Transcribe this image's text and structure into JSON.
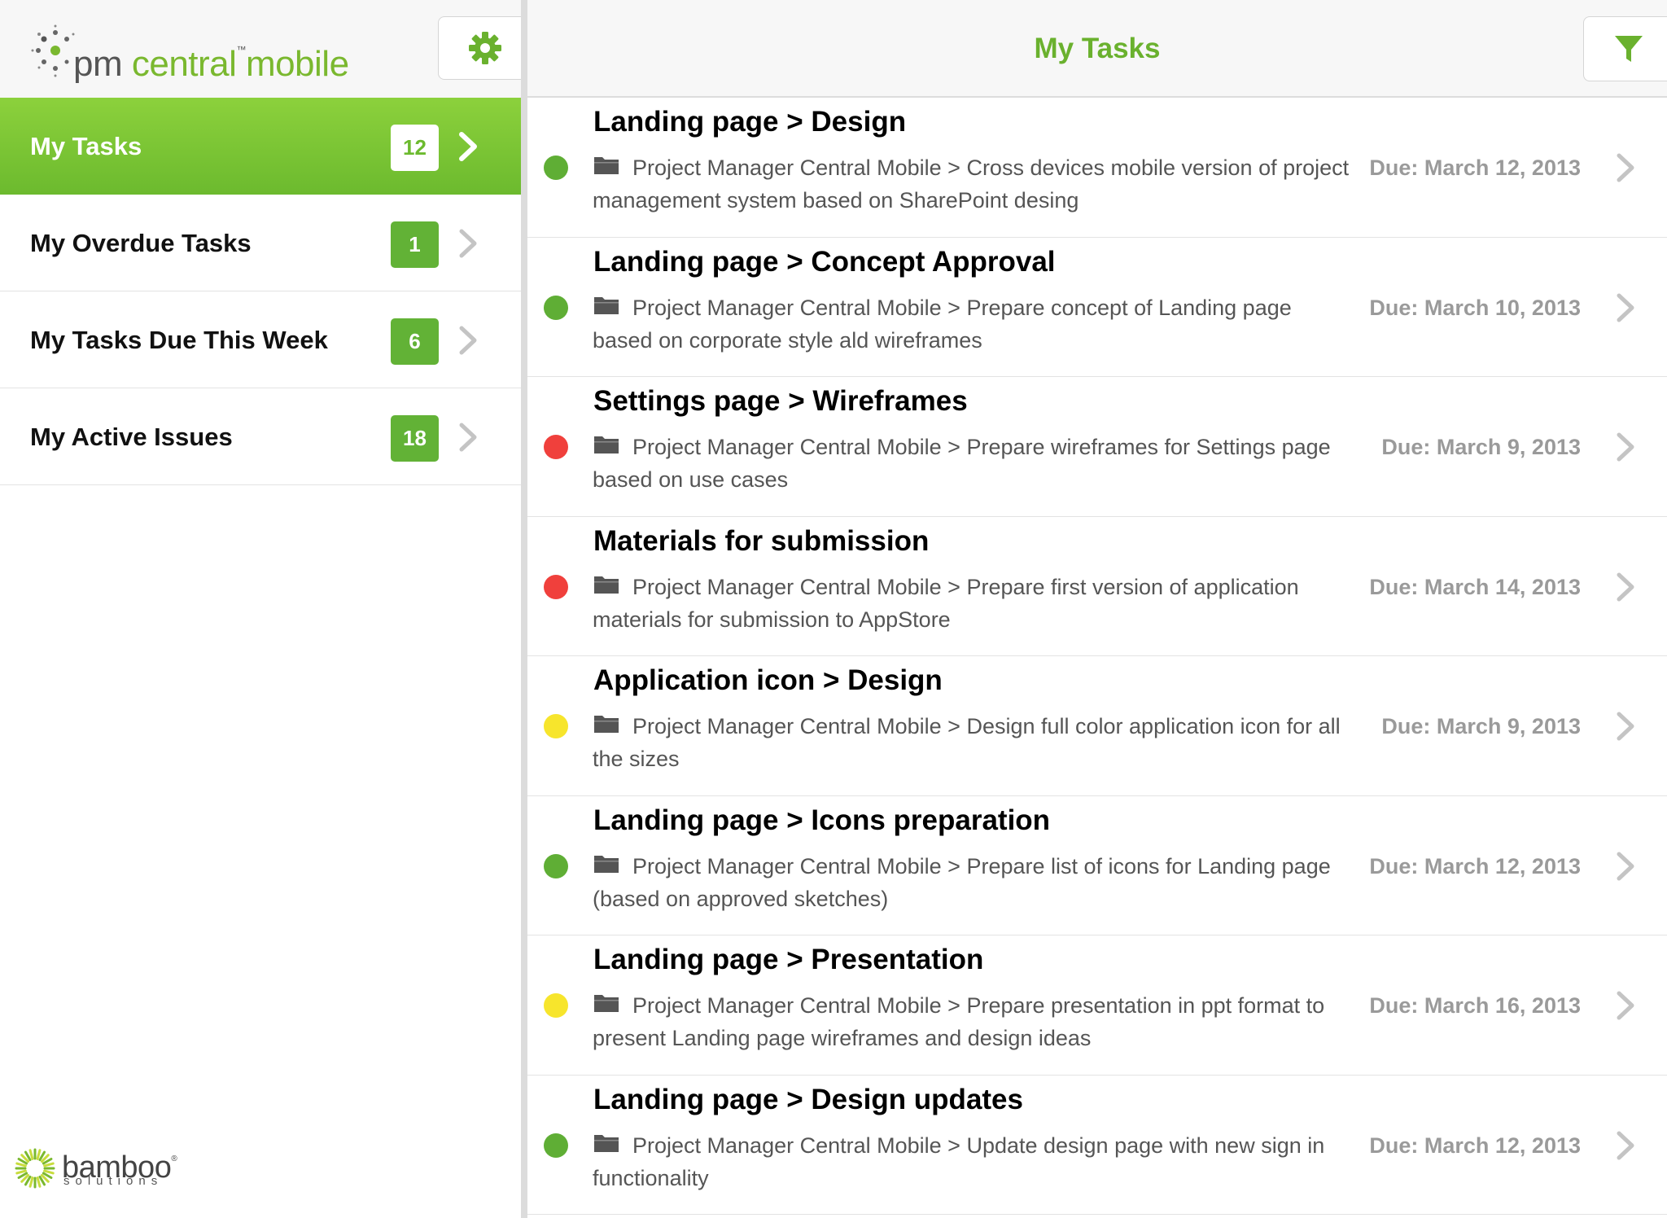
{
  "app": {
    "logo": {
      "pm": "pm",
      "central": "central",
      "tm": "™",
      "mobile": "mobile"
    },
    "settings_icon": "gear-icon"
  },
  "sidebar": {
    "items": [
      {
        "label": "My Tasks",
        "count": "12",
        "active": true
      },
      {
        "label": "My Overdue Tasks",
        "count": "1",
        "active": false
      },
      {
        "label": "My Tasks Due This Week",
        "count": "6",
        "active": false
      },
      {
        "label": "My Active Issues",
        "count": "18",
        "active": false
      }
    ],
    "footer": {
      "brand": "bamboo",
      "reg": "®",
      "sub": "solutions"
    }
  },
  "main": {
    "title": "My Tasks",
    "filter_icon": "funnel-icon",
    "tasks": [
      {
        "title": "Landing page > Design",
        "status": "green",
        "desc": "Project Manager Central Mobile > Cross devices mobile version of project management system based on SharePoint desing",
        "due": "Due: March 12, 2013"
      },
      {
        "title": "Landing page > Concept Approval",
        "status": "green",
        "desc": "Project Manager Central Mobile > Prepare concept of Landing page based on corporate style ald wireframes",
        "due": "Due: March 10, 2013"
      },
      {
        "title": "Settings page > Wireframes",
        "status": "red",
        "desc": "Project Manager Central Mobile > Prepare wireframes for Settings page based on use cases",
        "due": "Due: March 9, 2013"
      },
      {
        "title": "Materials for submission",
        "status": "red",
        "desc": "Project Manager Central Mobile > Prepare first version of application materials for submission to AppStore",
        "due": "Due: March 14, 2013"
      },
      {
        "title": "Application icon > Design",
        "status": "yellow",
        "desc": "Project Manager Central Mobile > Design full color application icon for all the sizes",
        "due": "Due: March 9, 2013"
      },
      {
        "title": "Landing page > Icons preparation",
        "status": "green",
        "desc": "Project Manager Central Mobile > Prepare list of icons for Landing page (based on approved sketches)",
        "due": "Due: March 12, 2013"
      },
      {
        "title": "Landing page > Presentation",
        "status": "yellow",
        "desc": "Project Manager Central Mobile > Prepare presentation in ppt format to present Landing page wireframes and design ideas",
        "due": "Due: March 16, 2013"
      },
      {
        "title": "Landing page > Design updates",
        "status": "green",
        "desc": "Project Manager Central Mobile > Update design page with new sign in functionality",
        "due": "Due: March 12, 2013"
      }
    ]
  },
  "colors": {
    "accent": "#6ab12e",
    "status_green": "#5fae35",
    "status_red": "#f0403c",
    "status_yellow": "#f7e52c",
    "badge": "#62b236"
  }
}
